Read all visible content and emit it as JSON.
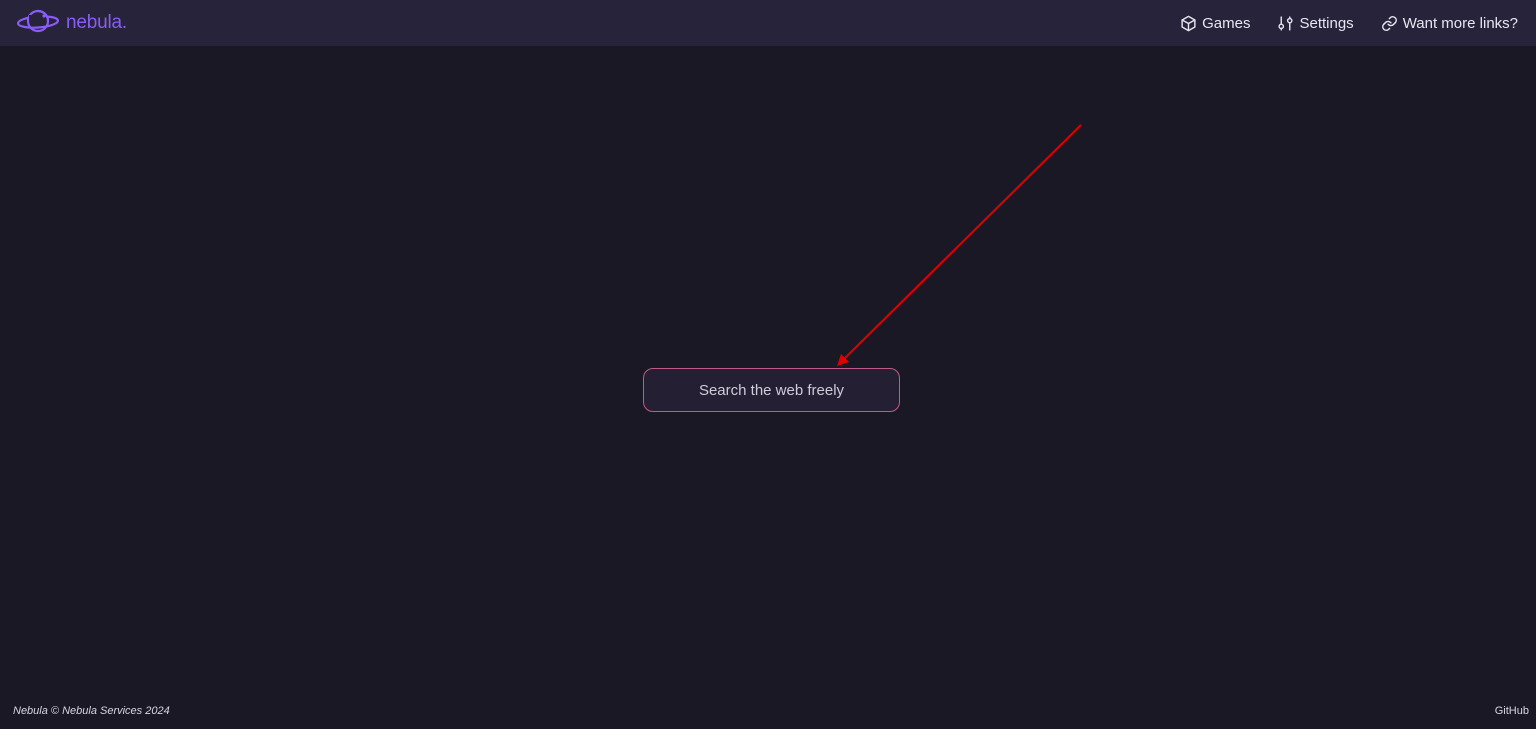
{
  "brand": {
    "name": "nebula.",
    "logo_icon": "planet-icon",
    "color": "#8a5cf6"
  },
  "nav": {
    "items": [
      {
        "label": "Games",
        "icon": "cube-icon"
      },
      {
        "label": "Settings",
        "icon": "sliders-icon"
      },
      {
        "label": "Want more links?",
        "icon": "link-icon"
      }
    ]
  },
  "search": {
    "placeholder": "Search the web freely",
    "value": "",
    "border_color": "#c05a86"
  },
  "annotation": {
    "color": "#e00000"
  },
  "footer": {
    "copyright": "Nebula © Nebula Services 2024",
    "github_label": "GitHub"
  },
  "colors": {
    "background": "#1b1826",
    "navbar": "#27233a"
  }
}
